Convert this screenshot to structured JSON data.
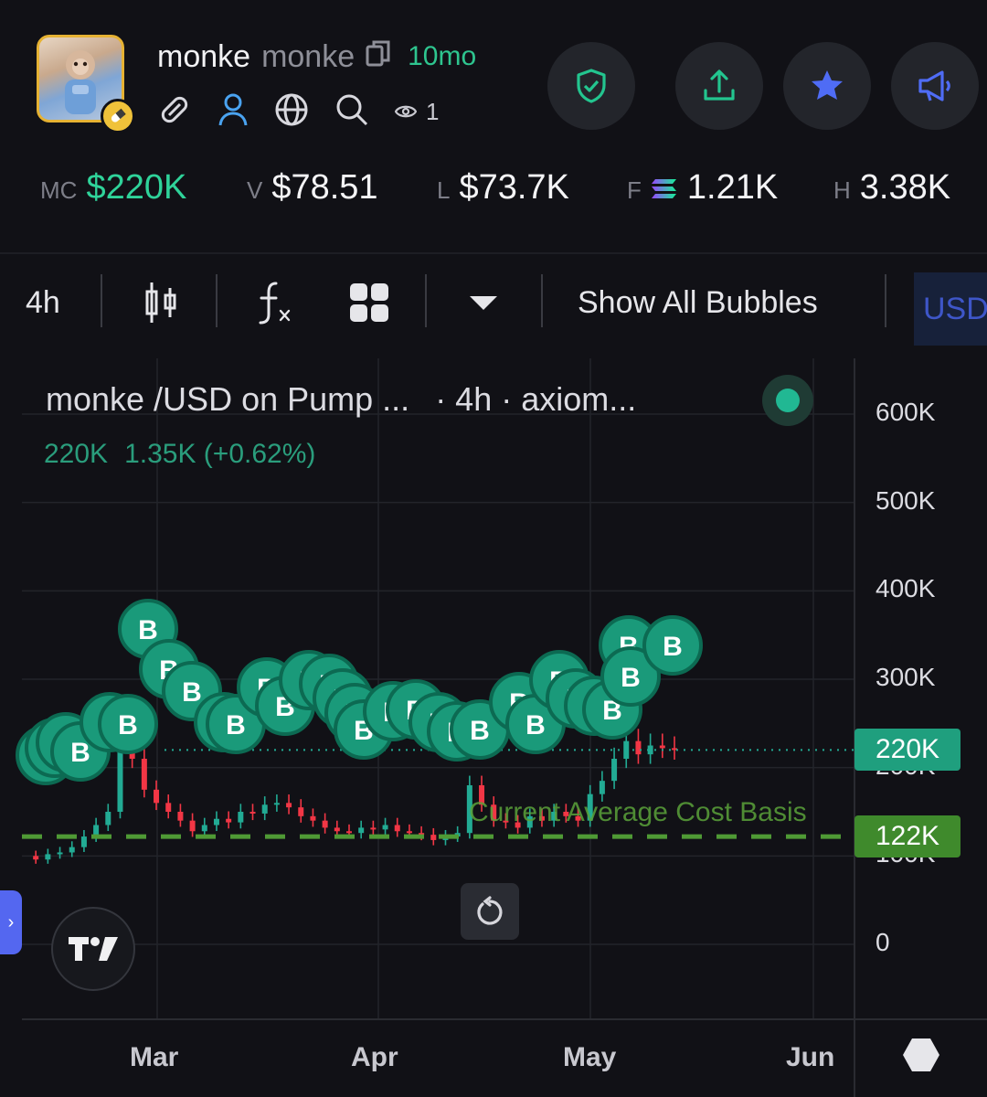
{
  "token": {
    "name": "monke",
    "symbol": "monke",
    "age": "10mo",
    "watchers": "1"
  },
  "header_icons": [
    "link-icon",
    "user-icon",
    "globe-icon",
    "search-icon",
    "eye-icon"
  ],
  "actions": [
    "shield-check-button",
    "share-button",
    "favorite-button",
    "megaphone-button"
  ],
  "stats": [
    {
      "key": "MC",
      "value": "$220K",
      "color": "#2fd39a"
    },
    {
      "key": "V",
      "value": "$78.51",
      "color": "#f4f4f6"
    },
    {
      "key": "L",
      "value": "$73.7K",
      "color": "#f4f4f6"
    },
    {
      "key": "F",
      "value": "1.21K",
      "color": "#f4f4f6",
      "icon": "solana-icon"
    },
    {
      "key": "H",
      "value": "3.38K",
      "color": "#f4f4f6"
    }
  ],
  "toolbar": {
    "interval": "4h",
    "bubbles_label": "Show All Bubbles",
    "currency": "USD"
  },
  "chart_data": {
    "type": "candlestick",
    "title": "monke /USD on Pump ...",
    "interval_label": "· 4h · axiom...",
    "last": "220K",
    "change": "1.35K (+0.62%)",
    "y_ticks": [
      "600K",
      "500K",
      "400K",
      "300K",
      "200K",
      "100K",
      "0"
    ],
    "ylim": [
      0,
      600000
    ],
    "x_ticks": [
      "Mar",
      "Apr",
      "May",
      "Jun"
    ],
    "current_price_label": "220K",
    "current_price": 220000,
    "avg_cost_label": "122K",
    "avg_cost": 122000,
    "avg_cost_text": "Current Average Cost Basis",
    "bubble_label": "B",
    "series": [
      {
        "name": "candles",
        "values": [
          100000,
          96000,
          102000,
          104000,
          110000,
          122000,
          135000,
          150000,
          245000,
          210000,
          175000,
          160000,
          150000,
          140000,
          128000,
          135000,
          142000,
          138000,
          150000,
          148000,
          158000,
          160000,
          155000,
          145000,
          140000,
          132000,
          128000,
          126000,
          132000,
          130000,
          135000,
          128000,
          126000,
          124000,
          118000,
          122000,
          126000,
          180000,
          158000,
          140000,
          138000,
          132000,
          145000,
          140000,
          150000,
          145000,
          140000,
          170000,
          185000,
          210000,
          230000,
          215000,
          225000,
          222000,
          220000
        ]
      }
    ]
  },
  "colors": {
    "up": "#22ab94",
    "down": "#f23645",
    "bubble": "#1a9a7a",
    "avg_cost": "#4f9a35",
    "price_tag": "#1f9f7e"
  }
}
